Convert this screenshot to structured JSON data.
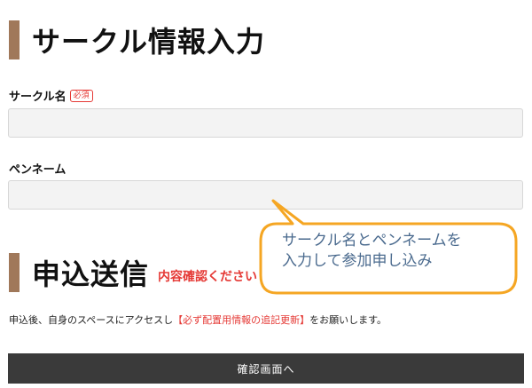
{
  "section1": {
    "title": "サークル情報入力"
  },
  "fields": {
    "circle_name": {
      "label": "サークル名",
      "badge": "必須",
      "value": "",
      "placeholder": ""
    },
    "pen_name": {
      "label": "ペンネーム",
      "value": "",
      "placeholder": ""
    }
  },
  "section2": {
    "title": "申込送信",
    "note": "内容確認ください"
  },
  "notice": {
    "prefix": "申込後、自身のスペースにアクセスし",
    "highlight": "【必ず配置用情報の追記更新】",
    "suffix": "をお願いします。"
  },
  "confirm_button": {
    "label": "確認画面へ"
  },
  "callout": {
    "line1": "サークル名とペンネームを",
    "line2": "入力して参加申し込み"
  },
  "colors": {
    "accent_bar": "#a0785a",
    "required": "#e53935",
    "callout_border": "#f5a623",
    "button_bg": "#3a3a3a"
  }
}
